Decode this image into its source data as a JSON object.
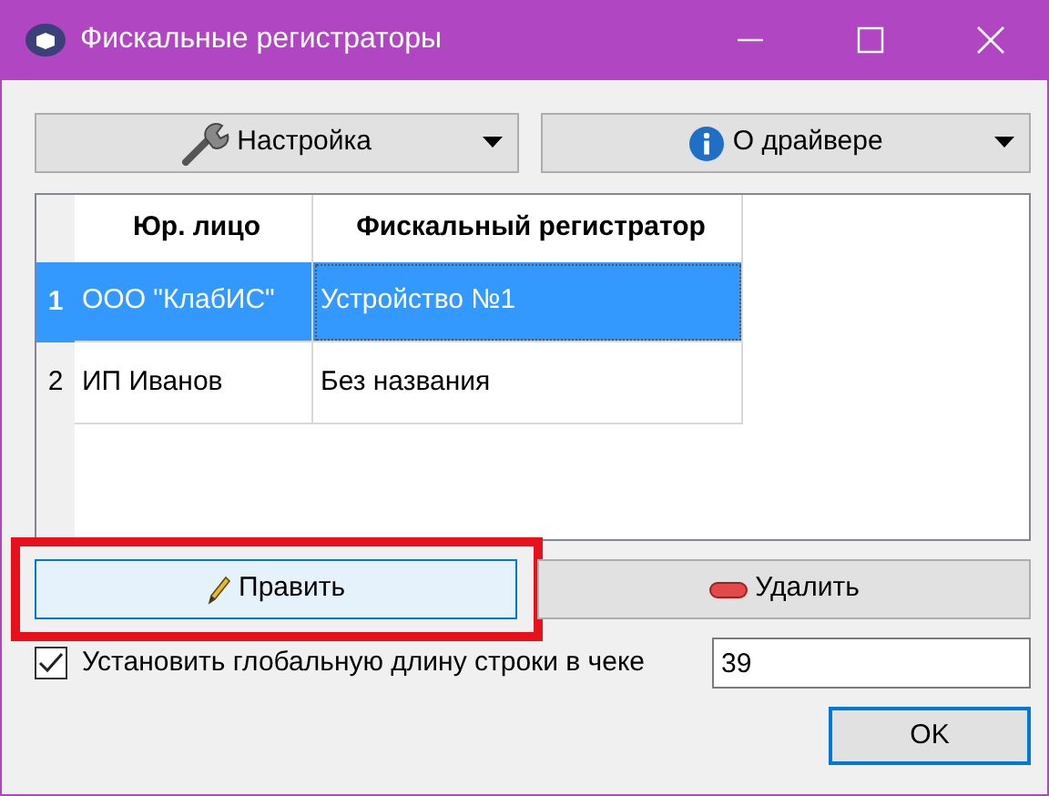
{
  "window": {
    "title": "Фискальные регистраторы"
  },
  "toolbar": [
    {
      "label": "Настройка",
      "dropdown": true
    },
    {
      "label": "О драйвере",
      "dropdown": true
    }
  ],
  "table": {
    "columns": [
      "Юр. лицо",
      "Фискальный регистратор"
    ],
    "rows": [
      {
        "number": "1",
        "cells": [
          "ООО \"КлабИС\"",
          "Устройство №1"
        ],
        "selected": true
      },
      {
        "number": "2",
        "cells": [
          "ИП Иванов",
          "Без названия"
        ],
        "selected": false
      }
    ]
  },
  "actions": [
    {
      "label": "Править",
      "highlighted": true
    },
    {
      "label": "Удалить",
      "highlighted": false
    }
  ],
  "line_length": {
    "label": "Установить глобальную длину строки в чеке",
    "checked": true,
    "value": "39"
  },
  "ok_button": "OK"
}
